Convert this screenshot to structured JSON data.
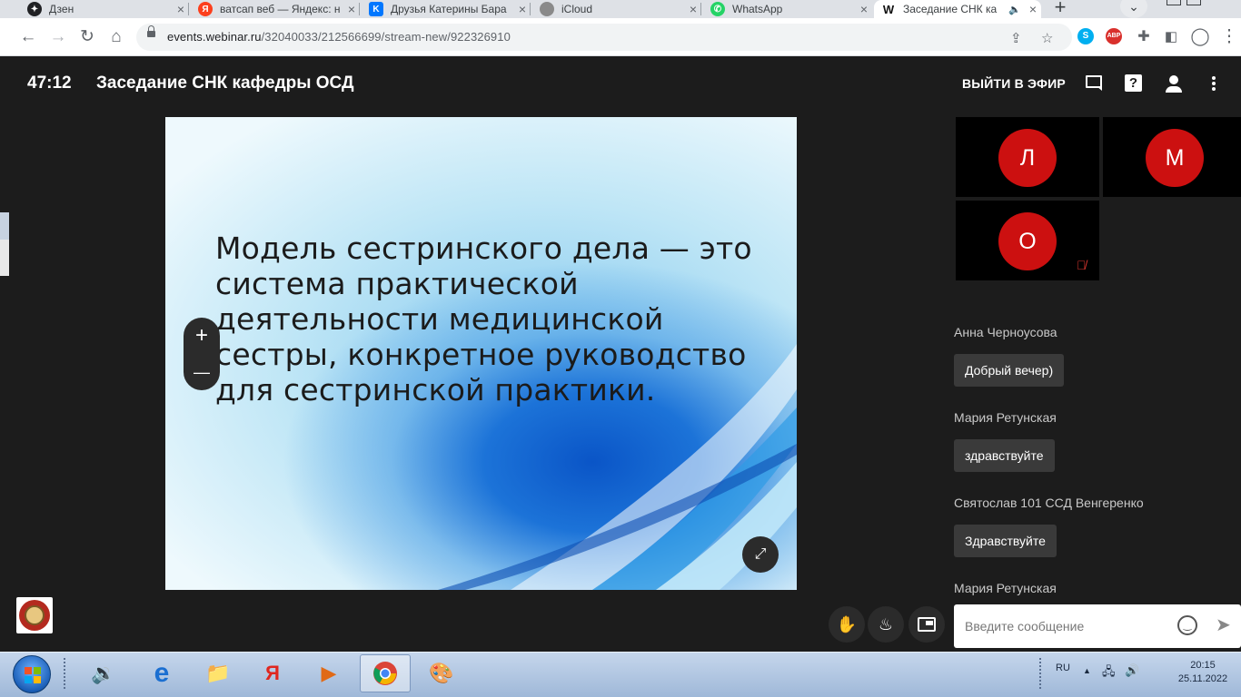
{
  "browser": {
    "tabs": [
      {
        "title": "Дзен",
        "favicon": "dzen-icon",
        "color": "#202124",
        "glyph": "✦"
      },
      {
        "title": "ватсап веб — Яндекс: н",
        "favicon": "yandex-icon",
        "color": "#fc3f1d",
        "glyph": "Я"
      },
      {
        "title": "Друзья Катерины Бара",
        "favicon": "vk-icon",
        "color": "#0077ff",
        "glyph": "K"
      },
      {
        "title": "iCloud",
        "favicon": "apple-icon",
        "color": "#555555",
        "glyph": ""
      },
      {
        "title": "WhatsApp",
        "favicon": "whatsapp-icon",
        "color": "#25d366",
        "glyph": "✆"
      },
      {
        "title": "Заседание СНК ка",
        "favicon": "webinar-icon",
        "color": "#ffffff",
        "glyph": "W"
      }
    ],
    "close_glyph": "×",
    "new_tab_glyph": "+",
    "url_host": "events.webinar.ru",
    "url_path": "/32040033/212566699/stream-new/922326910",
    "extensions": [
      {
        "name": "skype-icon",
        "glyph": "S",
        "color": "#00aff0"
      },
      {
        "name": "adblock-icon",
        "glyph": "ABP",
        "color": "#d9302c"
      }
    ]
  },
  "webinar": {
    "timer": "47:12",
    "title": "Заседание СНК кафедры ОСД",
    "go_live": "ВЫЙТИ В ЭФИР",
    "slide_text": "Модель сестринского дела — это система практической деятельности медицинской сестры, конкретное руководство для сестринской практики.",
    "zoom_in": "+",
    "zoom_out": "—",
    "participants": [
      {
        "initial": "Л",
        "muted": false
      },
      {
        "initial": "М",
        "muted": false
      },
      {
        "initial": "О",
        "muted": true
      }
    ],
    "messages": [
      {
        "author": "Анна Черноусова",
        "text": "Добрый вечер)"
      },
      {
        "author": "Мария Ретунская",
        "text": "здравствуйте"
      },
      {
        "author": "Святослав 101 ССД Венгеренко",
        "text": "Здравствуйте"
      },
      {
        "author": "Мария Ретунская",
        "text": ""
      }
    ],
    "input_placeholder": "Введите сообщение",
    "avatar_color": "#cc1010"
  },
  "taskbar": {
    "language": "RU",
    "time": "20:15",
    "date": "25.11.2022",
    "apps": [
      "volume-app-icon",
      "internet-explorer-icon",
      "file-explorer-icon",
      "yandex-browser-icon",
      "media-player-icon",
      "chrome-icon",
      "paint-icon"
    ]
  }
}
